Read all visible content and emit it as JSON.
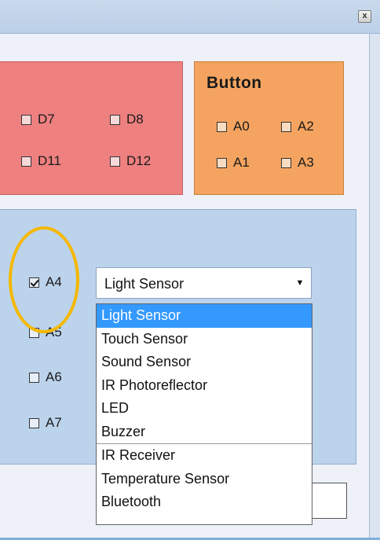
{
  "window": {
    "close_glyph": "x"
  },
  "digital_group": {
    "checkboxes": [
      {
        "label": "D7",
        "checked": false
      },
      {
        "label": "D8",
        "checked": false
      },
      {
        "label": "D11",
        "checked": false
      },
      {
        "label": "D12",
        "checked": false
      }
    ]
  },
  "button_group": {
    "title": "Button",
    "checkboxes": [
      {
        "label": "A0",
        "checked": false
      },
      {
        "label": "A2",
        "checked": false
      },
      {
        "label": "A1",
        "checked": false
      },
      {
        "label": "A3",
        "checked": false
      }
    ]
  },
  "analog_group": {
    "checkboxes": [
      {
        "label": "A4",
        "checked": true
      },
      {
        "label": "A5",
        "checked": false
      },
      {
        "label": "A6",
        "checked": false
      },
      {
        "label": "A7",
        "checked": false
      }
    ],
    "sensor_select": {
      "value": "Light Sensor",
      "options": [
        "Light Sensor",
        "Touch Sensor",
        "Sound Sensor",
        "IR Photoreflector",
        "LED",
        "Buzzer",
        "IR Receiver",
        "Temperature Sensor",
        "Bluetooth"
      ],
      "selected_index": 0
    }
  },
  "colors": {
    "digital_panel": "#ee8080",
    "button_panel": "#f4a460",
    "analog_panel": "#bcd3ec",
    "selection": "#3399ff",
    "highlight_ring": "#f5b800"
  }
}
